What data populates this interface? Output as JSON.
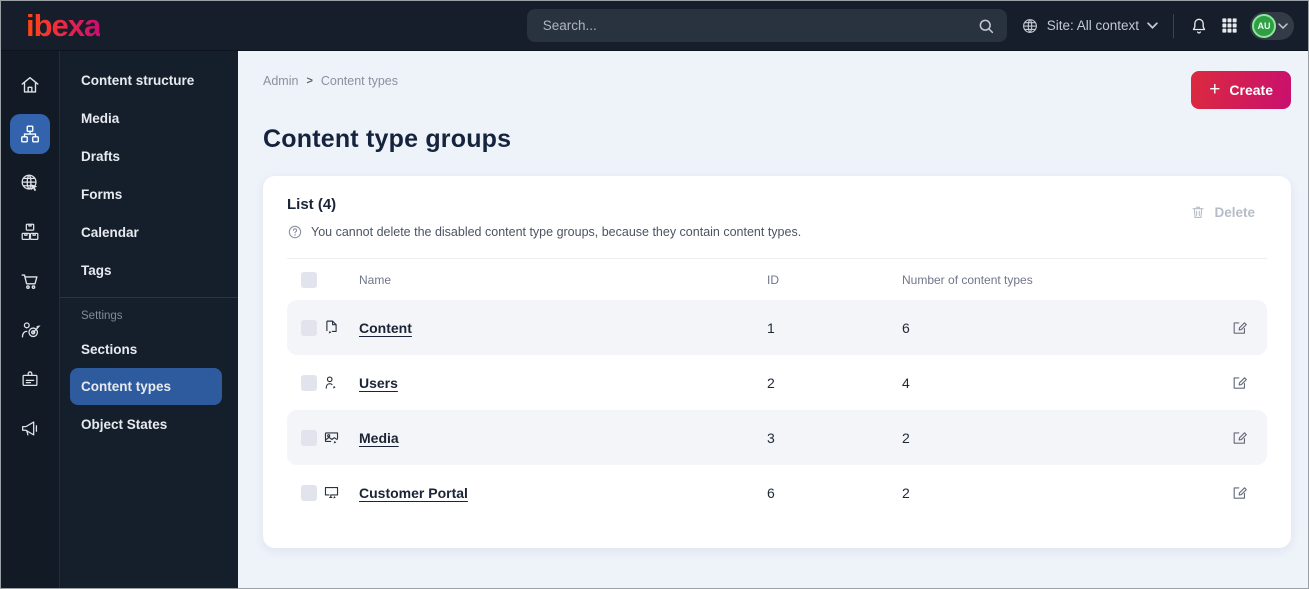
{
  "topbar": {
    "logo_text": "ibexa",
    "search_placeholder": "Search...",
    "site_context_label": "Site: All context",
    "avatar_initials": "AU"
  },
  "sidebar": {
    "items": [
      {
        "label": "Content structure"
      },
      {
        "label": "Media"
      },
      {
        "label": "Drafts"
      },
      {
        "label": "Forms"
      },
      {
        "label": "Calendar"
      },
      {
        "label": "Tags"
      }
    ],
    "settings_label": "Settings",
    "settings_items": [
      {
        "label": "Sections"
      },
      {
        "label": "Content types"
      },
      {
        "label": "Object States"
      }
    ]
  },
  "breadcrumb": {
    "root": "Admin",
    "separator": ">",
    "current": "Content types"
  },
  "page": {
    "title": "Content type groups",
    "create_label": "Create",
    "create_plus": "+"
  },
  "list": {
    "title": "List (4)",
    "info_text": "You cannot delete the disabled content type groups, because they contain content types.",
    "delete_label": "Delete"
  },
  "table": {
    "headers": {
      "name": "Name",
      "id": "ID",
      "count": "Number of content types"
    },
    "rows": [
      {
        "name": "Content",
        "id": "1",
        "count": "6"
      },
      {
        "name": "Users",
        "id": "2",
        "count": "4"
      },
      {
        "name": "Media",
        "id": "3",
        "count": "2"
      },
      {
        "name": "Customer Portal",
        "id": "6",
        "count": "2"
      }
    ]
  },
  "colors": {
    "topbar_bg": "#151e2a",
    "sidebar_selected_blue": "#2e5a9e",
    "rail_selected_blue": "#3263ac",
    "brand_gradient": [
      "#ff4713",
      "#cb0d72"
    ],
    "create_gradient": [
      "#db2a3e",
      "#c9106f"
    ],
    "avatar_green": "#2f9e44",
    "content_bg": "#eef2f9",
    "shaded_row_bg": "#f4f5f8"
  }
}
